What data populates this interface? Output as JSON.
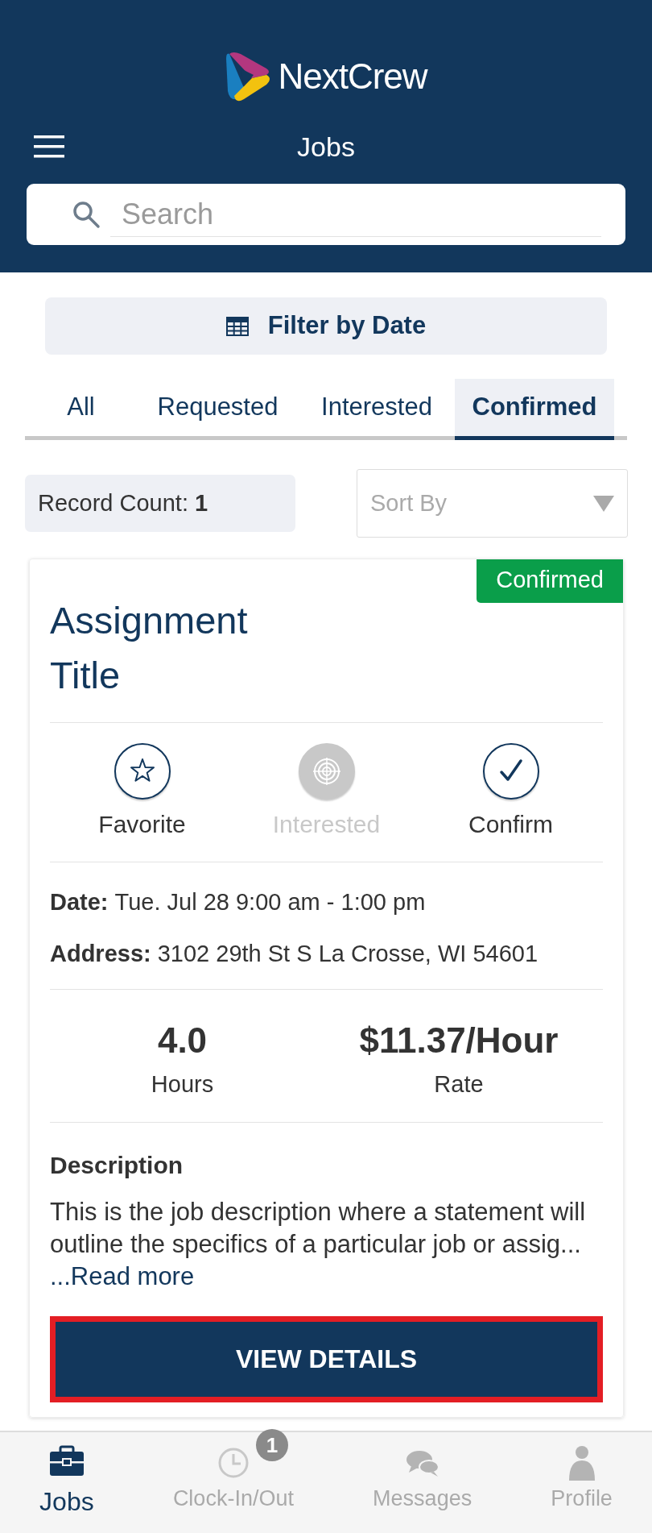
{
  "header": {
    "brand": "NextCrew",
    "title": "Jobs"
  },
  "search": {
    "placeholder": "Search"
  },
  "filter_button": {
    "label": "Filter by Date"
  },
  "tabs": [
    {
      "label": "All",
      "selected": false
    },
    {
      "label": "Requested",
      "selected": false
    },
    {
      "label": "Interested",
      "selected": false
    },
    {
      "label": "Confirmed",
      "selected": true
    }
  ],
  "record_count": {
    "label": "Record Count:",
    "value": "1"
  },
  "sort": {
    "placeholder": "Sort By"
  },
  "job": {
    "status": "Confirmed",
    "title": "Assignment Title",
    "actions": [
      {
        "kind": "favorite",
        "label": "Favorite",
        "disabled": false
      },
      {
        "kind": "interested",
        "label": "Interested",
        "disabled": true
      },
      {
        "kind": "confirm",
        "label": "Confirm",
        "disabled": false
      }
    ],
    "details": [
      {
        "label": "Date:",
        "value": "Tue. Jul 28 9:00 am - 1:00 pm"
      },
      {
        "label": "Address:",
        "value": "3102 29th St S La Crosse, WI 54601"
      }
    ],
    "stats": [
      {
        "value": "4.0",
        "label": "Hours"
      },
      {
        "value": "$11.37/Hour",
        "label": "Rate"
      }
    ],
    "description": {
      "heading": "Description",
      "text": "This is the job description where a statement will outline the specifics of a particular job or assig... ",
      "link": "...Read more"
    },
    "button": "VIEW DETAILS"
  },
  "bottom_nav": [
    {
      "kind": "jobs",
      "label": "Jobs",
      "selected": true
    },
    {
      "kind": "clock",
      "label": "Clock-In/Out",
      "selected": false,
      "badge": "1"
    },
    {
      "kind": "messages",
      "label": "Messages",
      "selected": false
    },
    {
      "kind": "profile",
      "label": "Profile",
      "selected": false
    }
  ]
}
